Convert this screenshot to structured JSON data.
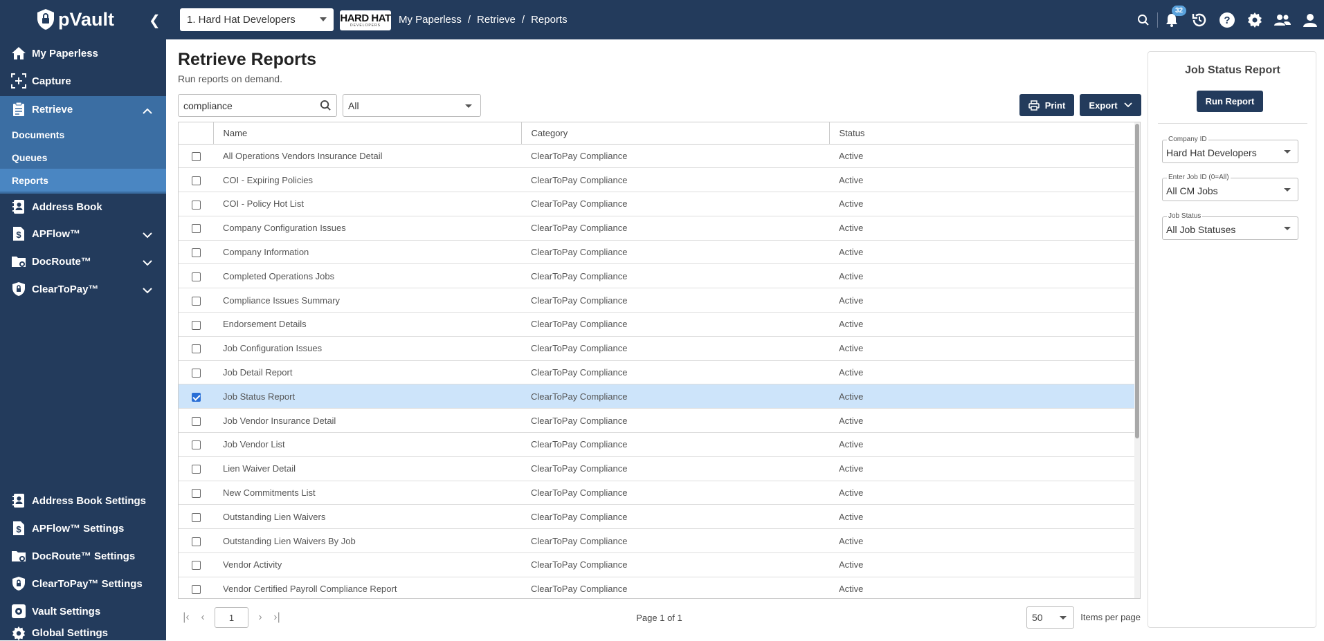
{
  "header": {
    "logo_text": "pVault",
    "company_select": "1. Hard Hat Developers",
    "brand_logo_text": "HARD HAT",
    "brand_logo_sub": "DEVELOPERS",
    "breadcrumb": [
      "My Paperless",
      "Retrieve",
      "Reports"
    ],
    "notification_count": "32"
  },
  "sidebar": {
    "items": [
      {
        "label": "My Paperless",
        "icon": "home-icon"
      },
      {
        "label": "Capture",
        "icon": "capture-icon"
      },
      {
        "label": "Retrieve",
        "icon": "clipboard-icon"
      },
      {
        "label": "Address Book",
        "icon": "address-book-icon"
      },
      {
        "label": "APFlow™",
        "icon": "dollar-doc-icon"
      },
      {
        "label": "DocRoute™",
        "icon": "folder-route-icon"
      },
      {
        "label": "ClearToPay™",
        "icon": "shield-lock-icon"
      }
    ],
    "retrieve_sub": [
      "Documents",
      "Queues",
      "Reports"
    ],
    "settings": [
      {
        "label": "Address Book Settings"
      },
      {
        "label": "APFlow™ Settings"
      },
      {
        "label": "DocRoute™ Settings"
      },
      {
        "label": "ClearToPay™ Settings"
      },
      {
        "label": "Vault Settings"
      },
      {
        "label": "Global Settings"
      }
    ]
  },
  "main": {
    "title": "Retrieve Reports",
    "subtitle": "Run reports on demand.",
    "search_value": "compliance",
    "filter_value": "All",
    "print_label": "Print",
    "export_label": "Export",
    "columns": [
      "Name",
      "Category",
      "Status"
    ],
    "rows": [
      {
        "name": "All Operations Vendors Insurance Detail",
        "category": "ClearToPay Compliance",
        "status": "Active",
        "checked": false
      },
      {
        "name": "COI - Expiring Policies",
        "category": "ClearToPay Compliance",
        "status": "Active",
        "checked": false
      },
      {
        "name": "COI - Policy Hot List",
        "category": "ClearToPay Compliance",
        "status": "Active",
        "checked": false
      },
      {
        "name": "Company Configuration Issues",
        "category": "ClearToPay Compliance",
        "status": "Active",
        "checked": false
      },
      {
        "name": "Company Information",
        "category": "ClearToPay Compliance",
        "status": "Active",
        "checked": false
      },
      {
        "name": "Completed Operations Jobs",
        "category": "ClearToPay Compliance",
        "status": "Active",
        "checked": false
      },
      {
        "name": "Compliance Issues Summary",
        "category": "ClearToPay Compliance",
        "status": "Active",
        "checked": false
      },
      {
        "name": "Endorsement Details",
        "category": "ClearToPay Compliance",
        "status": "Active",
        "checked": false
      },
      {
        "name": "Job Configuration Issues",
        "category": "ClearToPay Compliance",
        "status": "Active",
        "checked": false
      },
      {
        "name": "Job Detail Report",
        "category": "ClearToPay Compliance",
        "status": "Active",
        "checked": false
      },
      {
        "name": "Job Status Report",
        "category": "ClearToPay Compliance",
        "status": "Active",
        "checked": true
      },
      {
        "name": "Job Vendor Insurance Detail",
        "category": "ClearToPay Compliance",
        "status": "Active",
        "checked": false
      },
      {
        "name": "Job Vendor List",
        "category": "ClearToPay Compliance",
        "status": "Active",
        "checked": false
      },
      {
        "name": "Lien Waiver Detail",
        "category": "ClearToPay Compliance",
        "status": "Active",
        "checked": false
      },
      {
        "name": "New Commitments List",
        "category": "ClearToPay Compliance",
        "status": "Active",
        "checked": false
      },
      {
        "name": "Outstanding Lien Waivers",
        "category": "ClearToPay Compliance",
        "status": "Active",
        "checked": false
      },
      {
        "name": "Outstanding Lien Waivers By Job",
        "category": "ClearToPay Compliance",
        "status": "Active",
        "checked": false
      },
      {
        "name": "Vendor Activity",
        "category": "ClearToPay Compliance",
        "status": "Active",
        "checked": false
      },
      {
        "name": "Vendor Certified Payroll Compliance Report",
        "category": "ClearToPay Compliance",
        "status": "Active",
        "checked": false
      }
    ],
    "pager": {
      "page_input": "1",
      "info": "Page 1 of 1",
      "page_size": "50",
      "page_size_label": "Items per page"
    }
  },
  "right_panel": {
    "title": "Job Status Report",
    "run_label": "Run Report",
    "fields": [
      {
        "label": "Company ID",
        "value": "Hard Hat Developers"
      },
      {
        "label": "Enter Job ID (0=All)",
        "value": "All CM Jobs"
      },
      {
        "label": "Job Status",
        "value": "All Job Statuses"
      }
    ]
  },
  "colors": {
    "nav_bg": "#233b5c",
    "nav_expanded_bg": "#3b6ea3",
    "nav_active_bg": "#4a86c2",
    "selected_row": "#cde4fa",
    "badge": "#5aa2dc"
  }
}
